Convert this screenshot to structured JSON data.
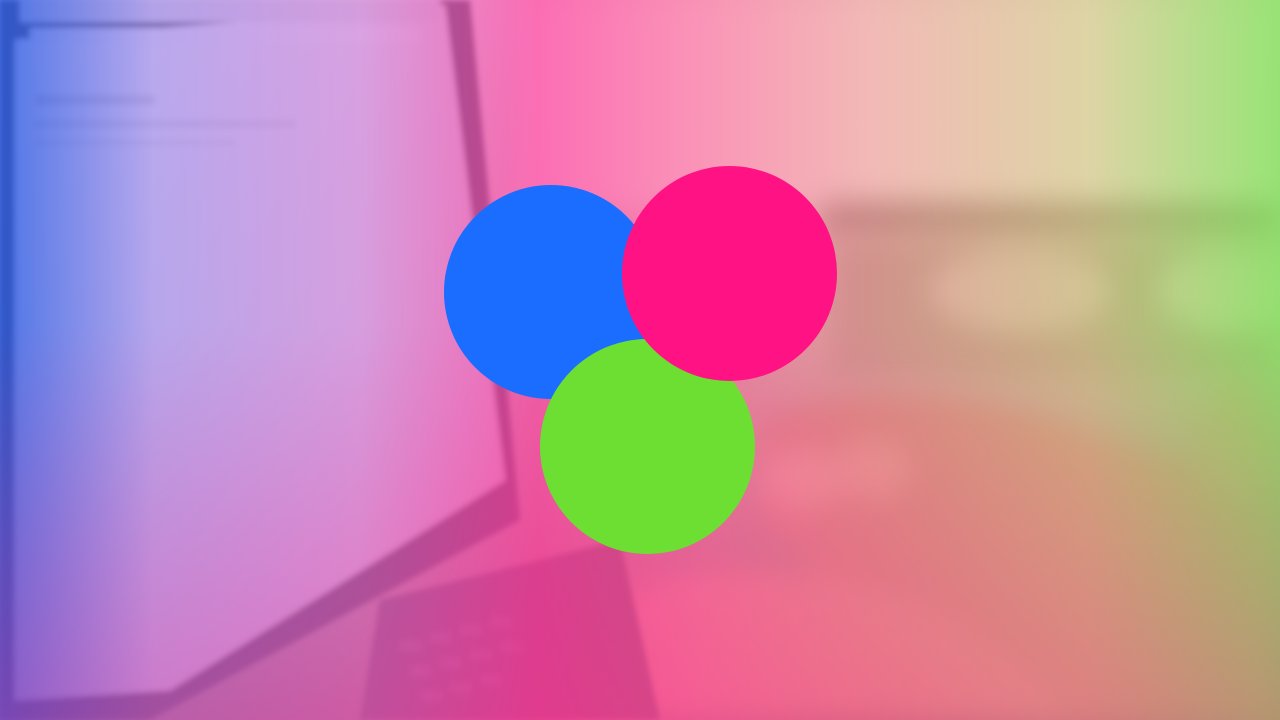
{
  "scene": {
    "description_free_colors": {
      "overlay_left": "#2a5ae6",
      "overlay_center": "#ff3ca0",
      "overlay_right": "#82e15a"
    }
  },
  "logo": {
    "circles": [
      {
        "name": "blue",
        "color": "#1a6dff"
      },
      {
        "name": "pink",
        "color": "#ff1283"
      },
      {
        "name": "green",
        "color": "#6ddf33"
      }
    ]
  }
}
